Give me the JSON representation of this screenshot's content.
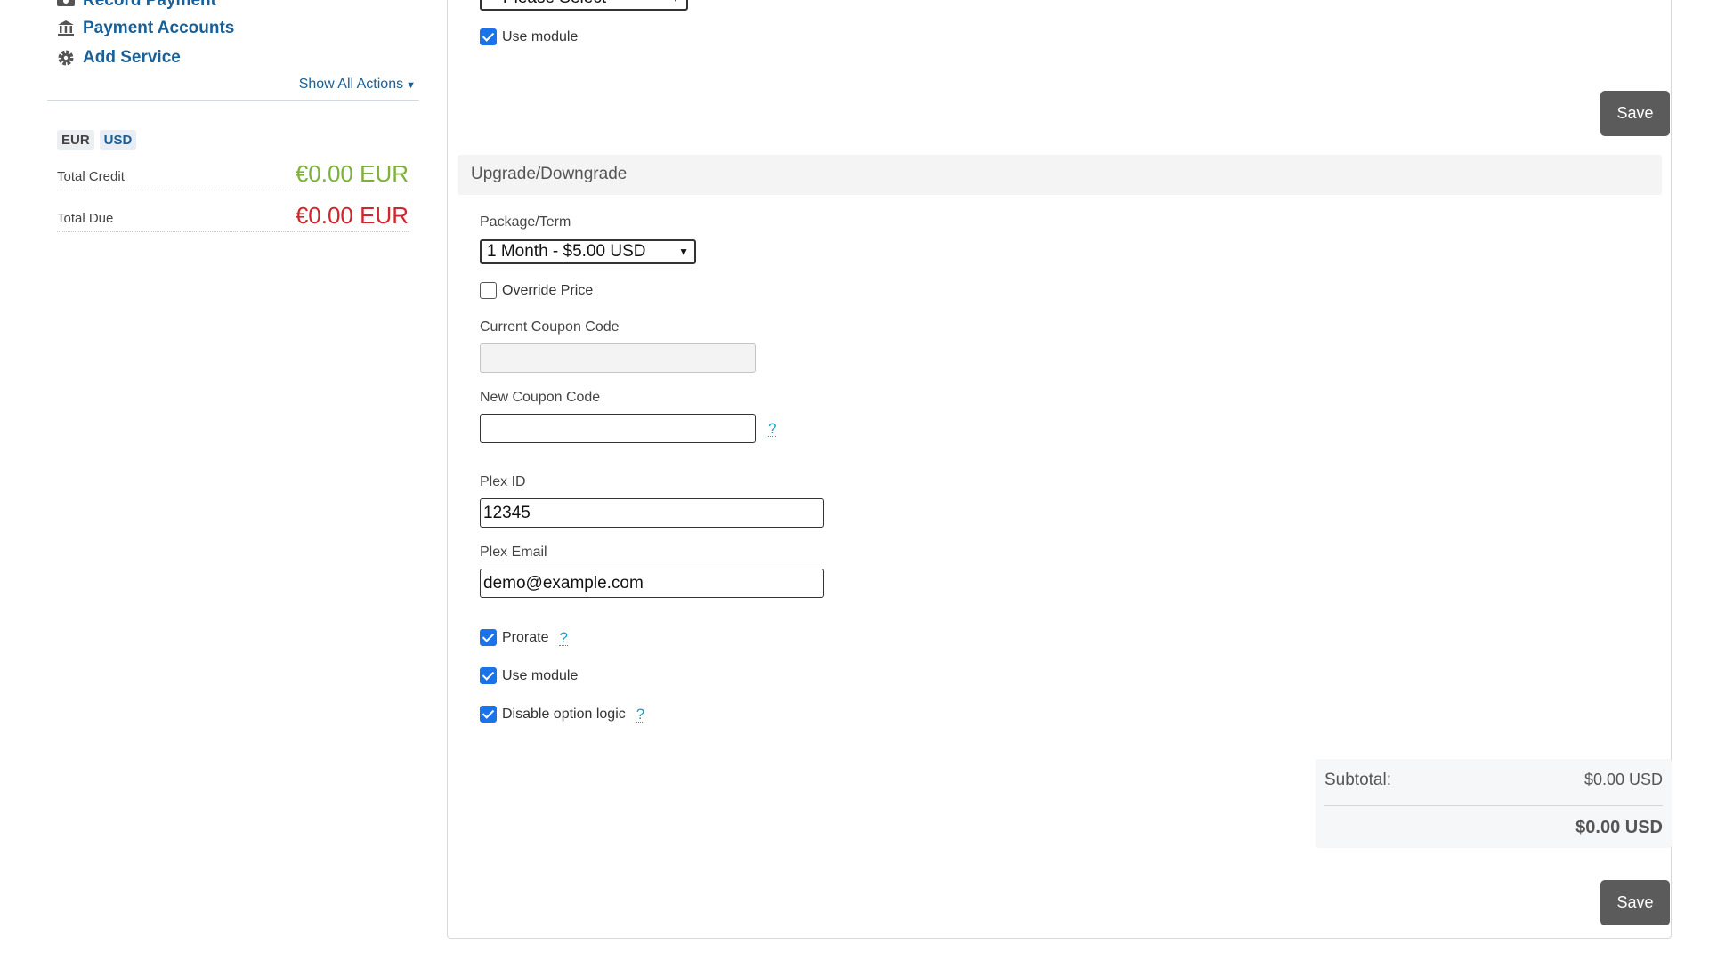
{
  "sidebar": {
    "actions": [
      {
        "label": "Record Payment",
        "icon": "money-icon"
      },
      {
        "label": "Payment Accounts",
        "icon": "bank-icon"
      },
      {
        "label": "Add Service",
        "icon": "gear-icon"
      }
    ],
    "show_all_label": "Show All Actions",
    "currencies": [
      "EUR",
      "USD"
    ],
    "active_currency": "USD",
    "total_credit_label": "Total Credit",
    "total_credit_value": "€0.00 EUR",
    "total_due_label": "Total Due",
    "total_due_value": "€0.00 EUR"
  },
  "top_section": {
    "select_value": "-- Please Select --",
    "use_module_label": "Use module",
    "save_label": "Save"
  },
  "upgrade": {
    "title": "Upgrade/Downgrade",
    "package_label": "Package/Term",
    "package_value": "1 Month - $5.00 USD",
    "override_price_label": "Override Price",
    "current_coupon_label": "Current Coupon Code",
    "current_coupon_value": "",
    "new_coupon_label": "New Coupon Code",
    "new_coupon_value": "",
    "help_glyph": "?",
    "plex_id_label": "Plex ID",
    "plex_id_value": "12345",
    "plex_email_label": "Plex Email",
    "plex_email_value": "demo@example.com",
    "prorate_label": "Prorate",
    "use_module_label": "Use module",
    "disable_option_logic_label": "Disable option logic",
    "subtotal_label": "Subtotal:",
    "subtotal_value": "$0.00 USD",
    "total_value": "$0.00 USD",
    "save_label": "Save"
  },
  "colors": {
    "link": "#1a5f96",
    "credit": "#7db23a",
    "due": "#d0262d",
    "button": "#5b5b5b",
    "help": "#1ea0c4"
  }
}
